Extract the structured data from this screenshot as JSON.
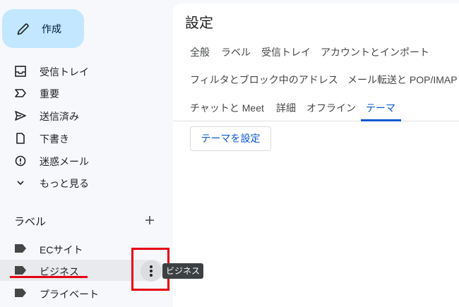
{
  "compose": {
    "label": "作成",
    "icon": "pencil-icon"
  },
  "nav": [
    {
      "id": "inbox",
      "label": "受信トレイ",
      "icon": "inbox-icon"
    },
    {
      "id": "important",
      "label": "重要",
      "icon": "important-icon"
    },
    {
      "id": "sent",
      "label": "送信済み",
      "icon": "send-icon"
    },
    {
      "id": "drafts",
      "label": "下書き",
      "icon": "draft-icon"
    },
    {
      "id": "spam",
      "label": "迷惑メール",
      "icon": "spam-icon"
    },
    {
      "id": "more",
      "label": "もっと見る",
      "icon": "chevron-down-icon"
    }
  ],
  "labels_section": {
    "heading": "ラベル",
    "add_icon": "plus-icon",
    "items": [
      {
        "label": "ECサイト",
        "icon": "label-icon"
      },
      {
        "label": "ビジネス",
        "icon": "label-icon",
        "hovered": true
      },
      {
        "label": "プライベート",
        "icon": "label-icon"
      }
    ],
    "more_icon": "more-vert-icon",
    "tooltip": "ビジネス"
  },
  "settings": {
    "title": "設定",
    "tabs": [
      "全般",
      "ラベル",
      "受信トレイ",
      "アカウントとインポート",
      "フィルタとブロック中のアドレス",
      "メール転送と POP/IMAP",
      "チャットと Meet",
      "詳細",
      "オフライン",
      "テーマ"
    ],
    "active_tab": "テーマ",
    "set_theme_button": "テーマを設定"
  },
  "colors": {
    "compose_bg": "#c2e7ff",
    "accent": "#0b57d0",
    "annotation_red": "#e60012",
    "sidebar_bg": "#f6f8fc",
    "tooltip_bg": "#3c4043"
  }
}
